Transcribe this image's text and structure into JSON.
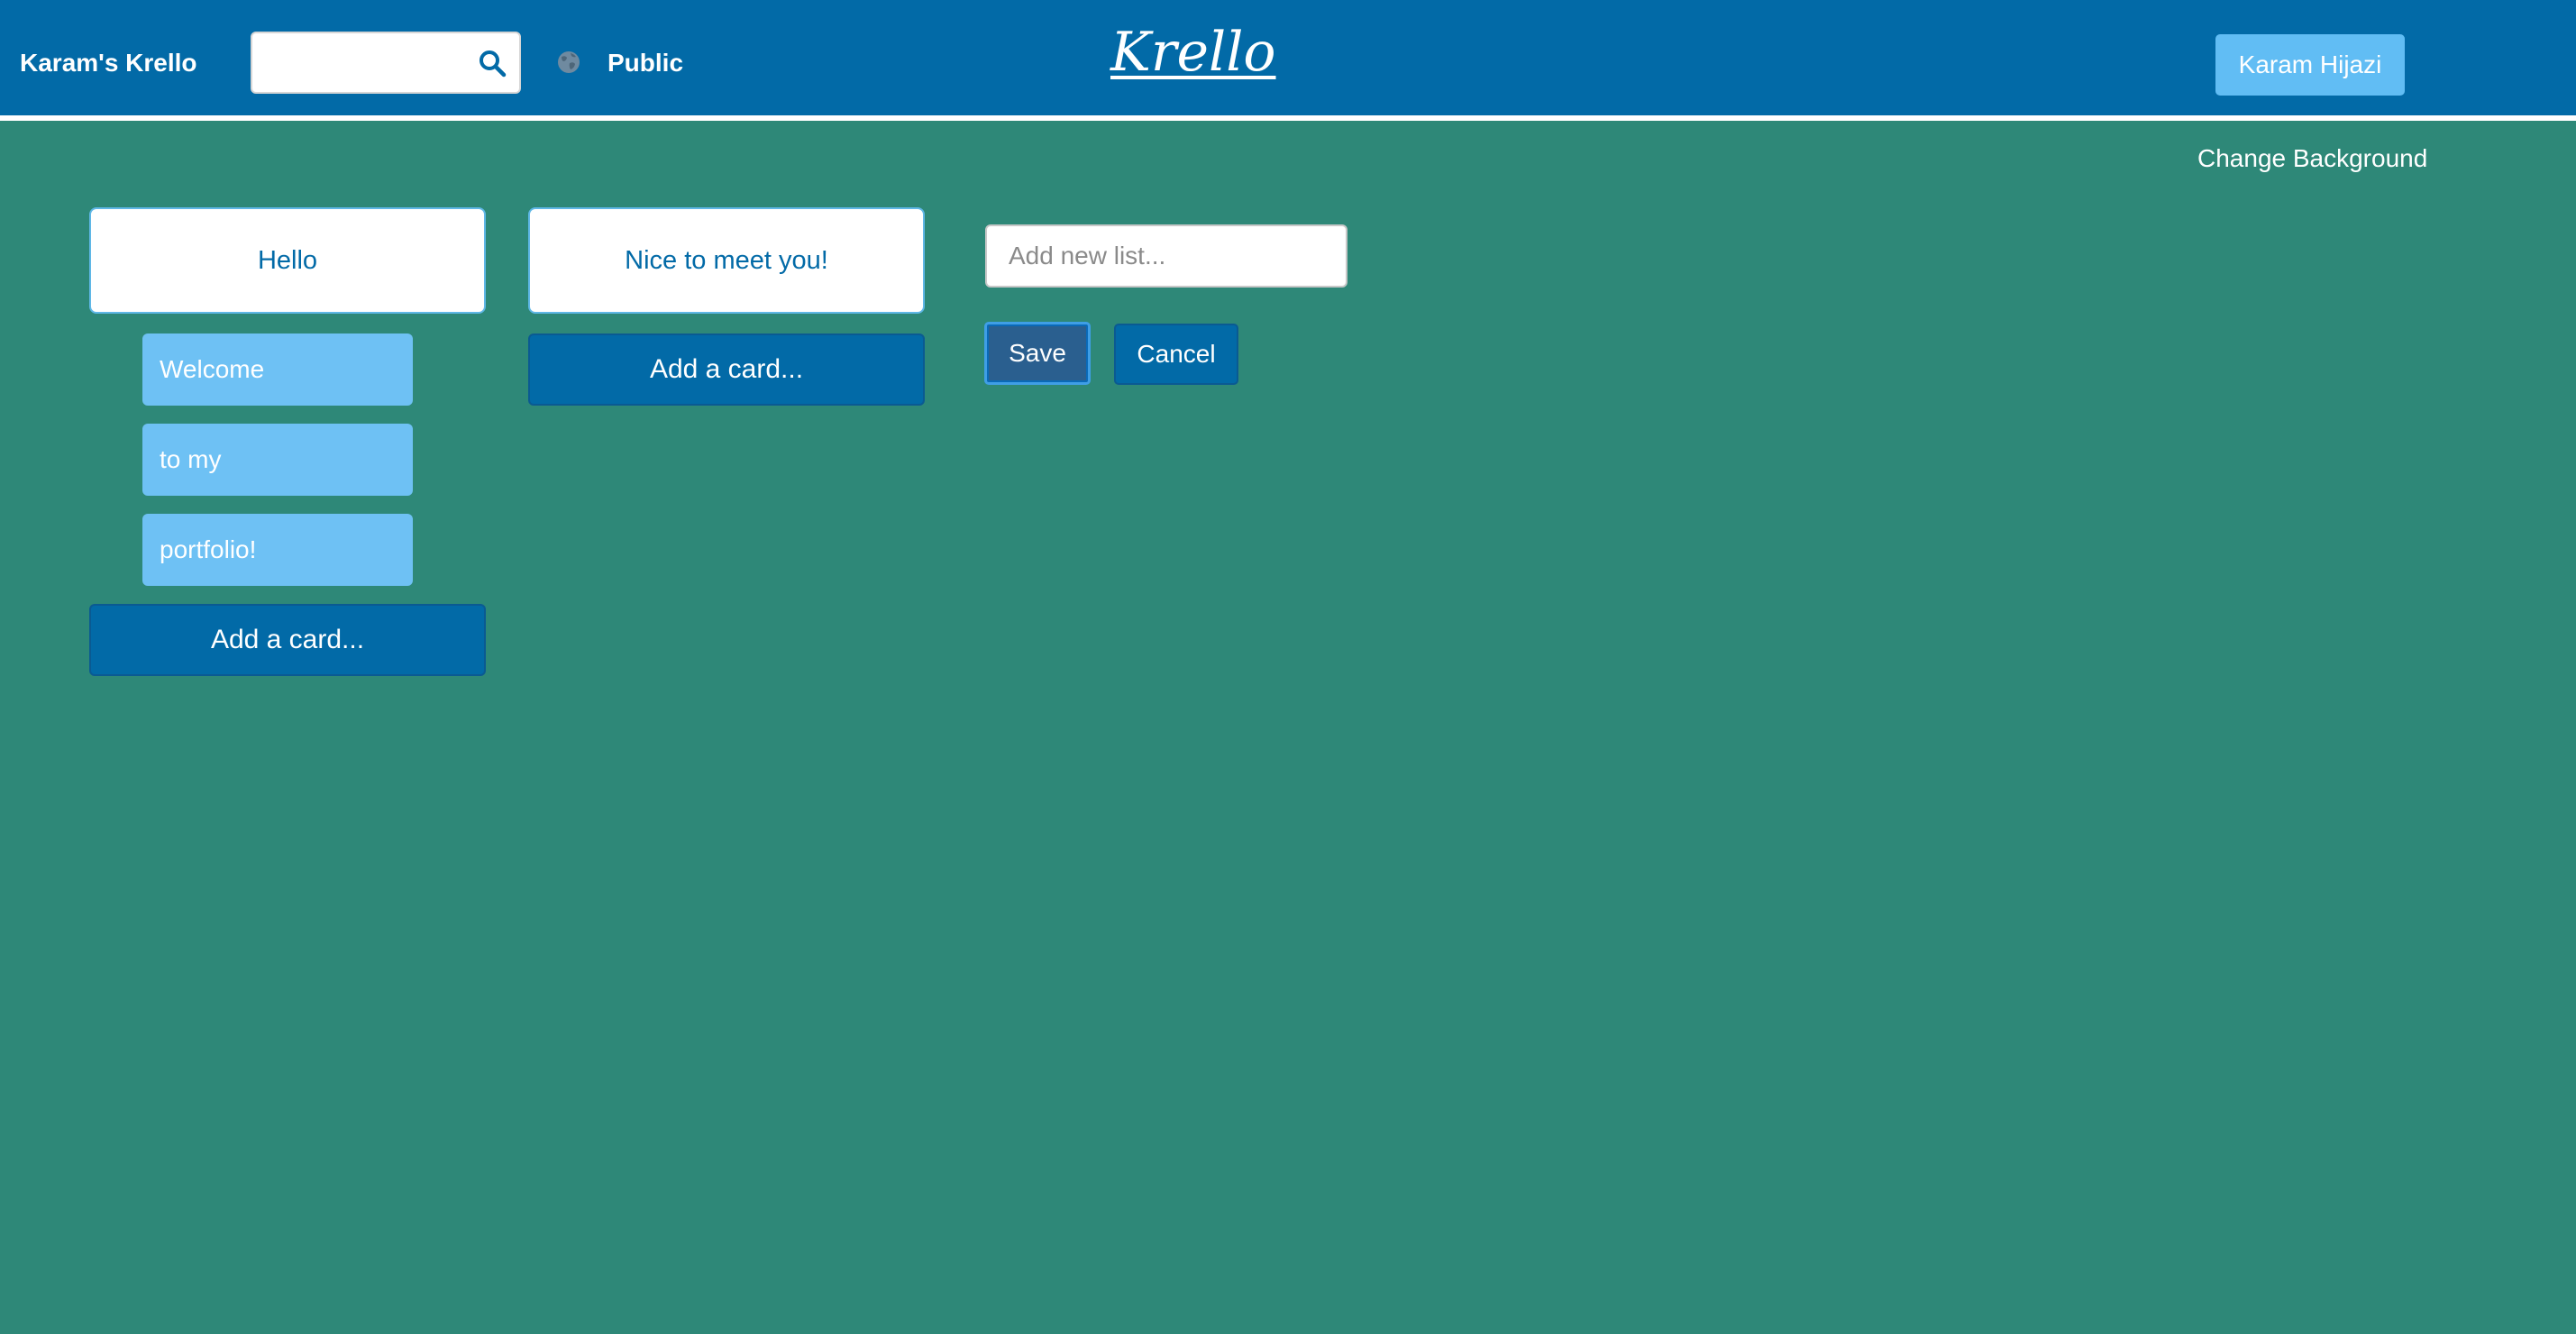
{
  "navbar": {
    "brand": "Karam's Krello",
    "search": {
      "value": "",
      "placeholder": "",
      "icon": "search-icon"
    },
    "visibility": {
      "icon": "globe-icon",
      "label": "Public"
    },
    "logo": "Krello",
    "user_button": "Karam Hijazi",
    "colors": {
      "navbar": "#026aa7",
      "user_button": "#61bdf4"
    }
  },
  "board": {
    "change_background": "Change Background",
    "background_color": "#2e8878",
    "lists": [
      {
        "title": "Hello",
        "cards": [
          "Welcome",
          "to my",
          "portfolio!"
        ],
        "add_card_label": "Add a card..."
      },
      {
        "title": "Nice to meet you!",
        "cards": [],
        "add_card_label": "Add a card..."
      }
    ],
    "new_list": {
      "value": "",
      "placeholder": "Add new list...",
      "save_label": "Save",
      "cancel_label": "Cancel"
    },
    "colors": {
      "card": "#6ec1f4",
      "add_card": "#026aa7",
      "list_title_text": "#026aa7"
    }
  }
}
